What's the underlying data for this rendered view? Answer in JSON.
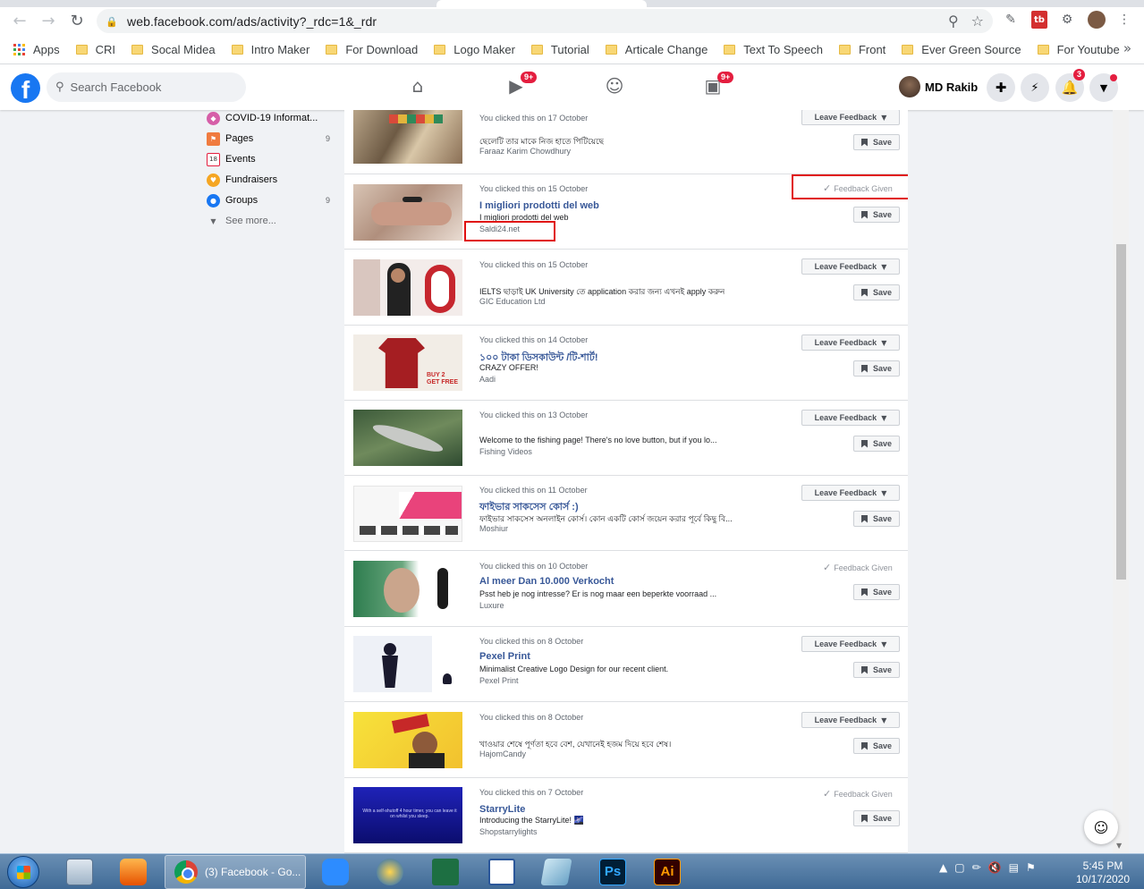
{
  "browser": {
    "url": "web.facebook.com/ads/activity?_rdc=1&_rdr",
    "bookmarks": [
      "Apps",
      "CRI",
      "Socal Midea",
      "Intro Maker",
      "For Download",
      "Logo Maker",
      "Tutorial",
      "Articale Change",
      "Text To Speech",
      "Front",
      "Ever Green Source",
      "For Youtube"
    ],
    "more_glyph": "»"
  },
  "header": {
    "logo": "f",
    "search_placeholder": "Search Facebook",
    "watch_badge": "9+",
    "gaming_badge": "9+",
    "user_name": "MD Rakib",
    "notif_badge": "3"
  },
  "sidebar": {
    "items": [
      {
        "label": "COVID-19 Informat...",
        "count": ""
      },
      {
        "label": "Pages",
        "count": "9"
      },
      {
        "label": "Events",
        "count": ""
      },
      {
        "label": "Fundraisers",
        "count": ""
      },
      {
        "label": "Groups",
        "count": "9"
      },
      {
        "label": "See more...",
        "count": ""
      }
    ],
    "events_num": "18"
  },
  "labels": {
    "leave_feedback": "Leave Feedback",
    "feedback_given": "Feedback Given",
    "save": "Save"
  },
  "ads": [
    {
      "clicked": "You clicked this on 17 October",
      "title": "",
      "body": "ছেলেটি তার মাকে নিজ হাতে পিটিয়েছে",
      "source": "Faraaz Karim Chowdhury",
      "feedback": "leave"
    },
    {
      "clicked": "You clicked this on 15 October",
      "title": "I migliori prodotti del web",
      "body": "I migliori prodotti del web",
      "source": "Saldi24.net",
      "feedback": "given"
    },
    {
      "clicked": "You clicked this on 15 October",
      "title": "",
      "body": "IELTS ছাড়াই UK University তে application করার জন্য এখনই apply করুন",
      "source": "GIC Education Ltd",
      "feedback": "leave"
    },
    {
      "clicked": "You clicked this on 14 October",
      "title": "১০০ টাকা ডিসকাউন্ট /টি-শার্ট!",
      "body": "CRAZY OFFER!",
      "source": "Aadi",
      "feedback": "leave"
    },
    {
      "clicked": "You clicked this on 13 October",
      "title": "",
      "body": "Welcome to the fishing page! There's no love button, but if you lo...",
      "source": "Fishing Videos",
      "feedback": "leave"
    },
    {
      "clicked": "You clicked this on 11 October",
      "title": "ফাইভার সাকসেস কোর্স :)",
      "body": "ফাইভার সাকসেস অনলাইন কোর্স। কোন একটি কোর্স জয়েন করার পূর্বে কিছু বি...",
      "source": "Moshiur",
      "feedback": "leave"
    },
    {
      "clicked": "You clicked this on 10 October",
      "title": "Al meer Dan 10.000 Verkocht",
      "body": "Psst heb je nog intresse? Er is nog maar een beperkte voorraad ...",
      "source": "Luxure",
      "feedback": "given"
    },
    {
      "clicked": "You clicked this on 8 October",
      "title": "Pexel Print",
      "body": "Minimalist Creative Logo Design for our recent client.",
      "source": "Pexel Print",
      "feedback": "leave"
    },
    {
      "clicked": "You clicked this on 8 October",
      "title": "",
      "body": "খাওয়ার শেষে পূর্ণতা হবে বেশ, যেখানেই হজম দিয়ে হবে শেষ।",
      "source": "HajomCandy",
      "feedback": "leave"
    },
    {
      "clicked": "You clicked this on 7 October",
      "title": "StarryLite",
      "body": "Introducing the StarryLite! 🌌",
      "source": "Shopstarrylights",
      "feedback": "given"
    }
  ],
  "thumb_text": {
    "tshirt_buy": "BUY 2 GET FREE",
    "starry": "With a self-shutoff 4 hour timer, you can leave it on whilst you sleep."
  },
  "taskbar": {
    "chrome_label": "(3) Facebook - Go...",
    "ps": "Ps",
    "ai": "Ai",
    "time": "5:45 PM",
    "date": "10/17/2020"
  },
  "colors": {
    "fb_blue": "#1877f2",
    "link": "#385898",
    "badge_red": "#e41e3f",
    "highlight_box": "#e01010"
  }
}
